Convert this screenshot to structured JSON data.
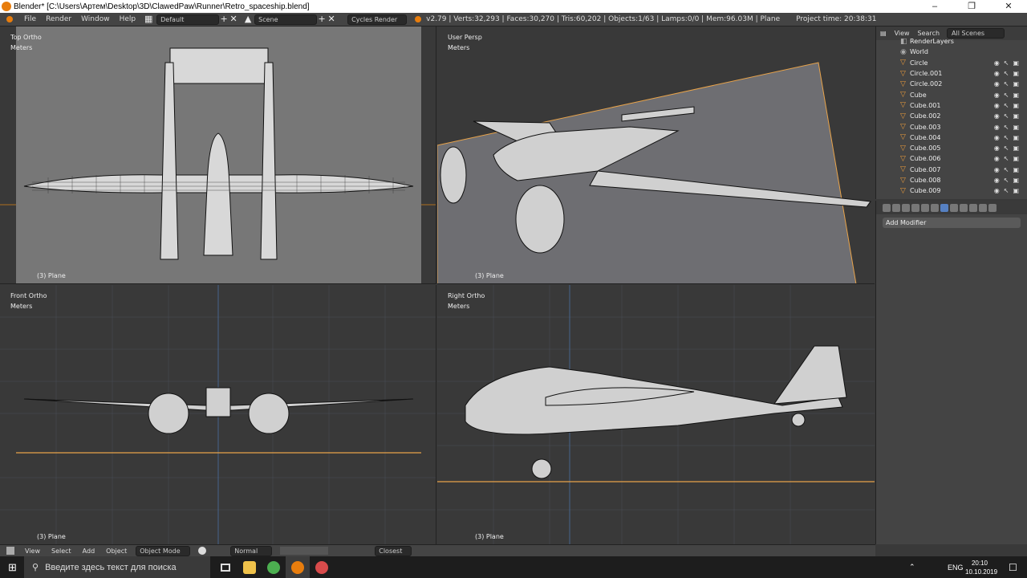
{
  "window": {
    "title": "Blender* [C:\\Users\\Артем\\Desktop\\3D\\ClawedPaw\\Runner\\Retro_spaceship.blend]",
    "minimize": "–",
    "maximize": "❐",
    "close": "✕"
  },
  "menu": {
    "items": [
      "File",
      "Render",
      "Window",
      "Help"
    ],
    "layout_value": "Default",
    "scene_value": "Scene",
    "engine_value": "Cycles Render",
    "stats": "v2.79 | Verts:32,293 | Faces:30,270 | Tris:60,202 | Objects:1/63 | Lamps:0/0 | Mem:96.03M | Plane",
    "project_time": "Project time: 20:38:31"
  },
  "viewports": [
    {
      "view": "Top Ortho",
      "units": "Meters",
      "object": "(3) Plane"
    },
    {
      "view": "User Persp",
      "units": "Meters",
      "object": "(3) Plane"
    },
    {
      "view": "Front Ortho",
      "units": "Meters",
      "object": "(3) Plane"
    },
    {
      "view": "Right Ortho",
      "units": "Meters",
      "object": "(3) Plane"
    }
  ],
  "outliner": {
    "header": [
      "View",
      "Search"
    ],
    "scenes_value": "All Scenes",
    "top_items": [
      "RenderLayers",
      "World"
    ],
    "objects": [
      "Circle",
      "Circle.001",
      "Circle.002",
      "Cube",
      "Cube.001",
      "Cube.002",
      "Cube.003",
      "Cube.004",
      "Cube.005",
      "Cube.006",
      "Cube.007",
      "Cube.008",
      "Cube.009"
    ]
  },
  "properties": {
    "add_modifier": "Add Modifier"
  },
  "bottom": {
    "items": [
      "View",
      "Select",
      "Add",
      "Object"
    ],
    "mode": "Object Mode",
    "pivot": "Normal",
    "snap": "Closest"
  },
  "taskbar": {
    "search_placeholder": "Введите здесь текст для поиска",
    "lang": "ENG",
    "time": "20:10",
    "date": "10.10.2019"
  },
  "colors": {
    "orange_accent": "#e8a34a",
    "blender_orange": "#e87d0d",
    "selected_blue": "#5680c2"
  }
}
